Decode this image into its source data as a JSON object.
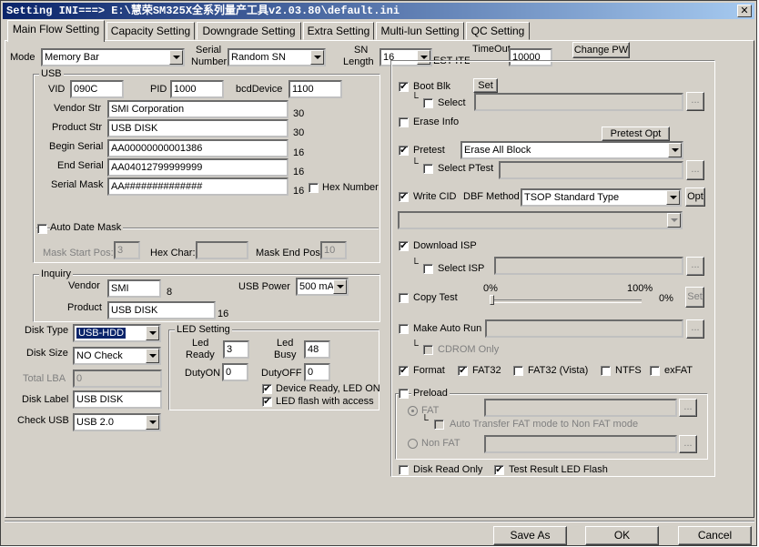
{
  "window": {
    "title": "Setting  INI===> E:\\慧荣SM325X全系列量产工具v2.03.80\\default.ini",
    "close_glyph": "✕"
  },
  "tabs": [
    {
      "label": "Main Flow Setting",
      "active": true
    },
    {
      "label": "Capacity Setting"
    },
    {
      "label": "Downgrade Setting"
    },
    {
      "label": "Extra Setting"
    },
    {
      "label": "Multi-lun Setting"
    },
    {
      "label": "QC Setting"
    }
  ],
  "top": {
    "mode_label": "Mode",
    "mode_value": "Memory Bar",
    "serial_number_label_1": "Serial",
    "serial_number_label_2": "Number",
    "serial_number_value": "Random SN",
    "sn_length_label_1": "SN",
    "sn_length_label_2": "Length",
    "sn_length_value": "16",
    "est_item_text": "EST ITEM",
    "timeout_label": "TimeOut",
    "timeout_value": "10000",
    "change_pw_label": "Change PW"
  },
  "usb": {
    "title": "USB",
    "vid_label": "VID",
    "vid_value": "090C",
    "pid_label": "PID",
    "pid_value": "1000",
    "bcd_label": "bcdDevice",
    "bcd_value": "1100",
    "vendor_str_label": "Vendor Str",
    "vendor_str_value": "SMI Corporation",
    "vendor_str_len": "30",
    "product_str_label": "Product Str",
    "product_str_value": "USB DISK",
    "product_str_len": "30",
    "begin_serial_label": "Begin Serial",
    "begin_serial_value": "AA00000000001386",
    "begin_serial_len": "16",
    "end_serial_label": "End Serial",
    "end_serial_value": "AA04012799999999",
    "end_serial_len": "16",
    "serial_mask_label": "Serial Mask",
    "serial_mask_value": "AA##############",
    "serial_mask_len": "16",
    "hex_number_label": "Hex Number",
    "auto_date_mask_label": "Auto Date Mask",
    "mask_start_pos_label": "Mask Start Pos:",
    "mask_start_pos_value": "3",
    "hex_char_label": "Hex Char:",
    "hex_char_value": "",
    "mask_end_pos_label": "Mask End Pos:",
    "mask_end_pos_value": "10"
  },
  "inquiry": {
    "title": "Inquiry",
    "vendor_label": "Vendor",
    "vendor_value": "SMI",
    "vendor_len": "8",
    "product_label": "Product",
    "product_value": "USB DISK",
    "product_len": "16",
    "usb_power_label": "USB Power",
    "usb_power_value": "500 mA"
  },
  "disk": {
    "disk_type_label": "Disk Type",
    "disk_type_value": "USB-HDD",
    "disk_size_label": "Disk Size",
    "disk_size_value": "NO Check",
    "total_lba_label": "Total LBA",
    "total_lba_value": "0",
    "disk_label_label": "Disk Label",
    "disk_label_value": "USB DISK",
    "check_usb_label": "Check USB",
    "check_usb_value": "USB 2.0"
  },
  "led": {
    "title": "LED Setting",
    "led_ready_label_1": "Led",
    "led_ready_label_2": "Ready",
    "led_ready_value": "3",
    "led_busy_label_1": "Led",
    "led_busy_label_2": "Busy",
    "led_busy_value": "48",
    "duty_on_label": "DutyON",
    "duty_on_value": "0",
    "duty_off_label": "DutyOFF",
    "duty_off_value": "0",
    "device_ready_label": "Device Ready, LED ON",
    "led_flash_label": "LED flash with access"
  },
  "right": {
    "boot_blk_label": "Boot Blk",
    "set_label": "Set",
    "select_label": "Select",
    "ellipsis": "...",
    "erase_info_label": "Erase Info",
    "pretest_opt_label": "Pretest Opt",
    "pretest_label": "Pretest",
    "pretest_value": "Erase All Block",
    "select_ptest_label": "Select PTest",
    "write_cid_label": "Write CID",
    "dbf_method_label": "DBF Method",
    "dbf_method_value": "TSOP Standard Type",
    "opt_label": "Opt",
    "download_isp_label": "Download ISP",
    "select_isp_label": "Select ISP",
    "copy_test_label": "Copy Test",
    "copy_min_label": "0%",
    "copy_max_label": "100%",
    "copy_value_label": "0%",
    "copy_test_progress": 0,
    "copy_set_label": "Set",
    "make_auto_run_label": "Make Auto Run",
    "cdrom_only_label": "CDROM Only",
    "format_label": "Format",
    "fat32_label": "FAT32",
    "fat32_vista_label": "FAT32 (Vista)",
    "ntfs_label": "NTFS",
    "exfat_label": "exFAT",
    "preload_label": "Preload",
    "fat_label": "FAT",
    "auto_transfer_label": "Auto Transfer FAT mode to Non FAT mode",
    "non_fat_label": "Non FAT",
    "disk_read_only_label": "Disk Read Only",
    "test_result_led_label": "Test Result LED Flash"
  },
  "bottom": {
    "save_as_label": "Save  As",
    "ok_label": "OK",
    "cancel_label": "Cancel"
  },
  "checkmark": "✔",
  "colors": {
    "title_start": "#0a246a",
    "title_end": "#a6caf0",
    "face": "#d4d0c8",
    "selection": "#0a246a"
  }
}
